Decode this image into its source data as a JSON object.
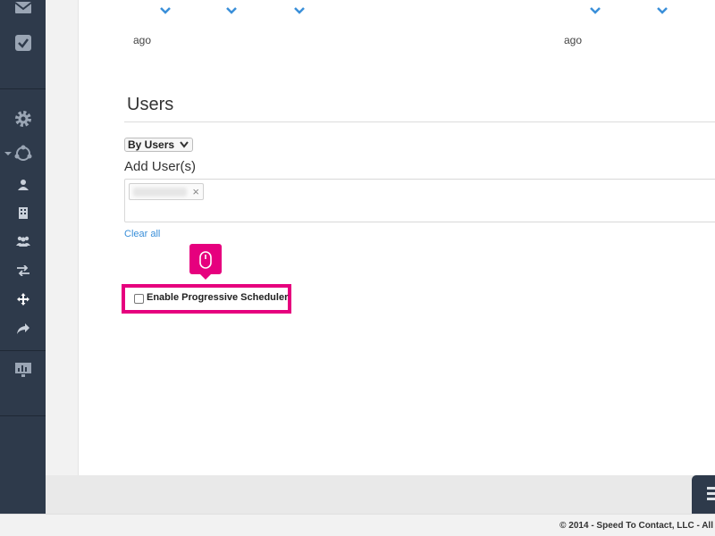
{
  "sidebar": {
    "icons": [
      {
        "name": "mail-icon"
      },
      {
        "name": "tasks-icon"
      },
      {
        "name": "gear-icon"
      },
      {
        "name": "workflow-icon"
      },
      {
        "name": "user-icon"
      },
      {
        "name": "building-icon"
      },
      {
        "name": "group-icon"
      },
      {
        "name": "transfer-icon"
      },
      {
        "name": "move-icon"
      },
      {
        "name": "forward-icon"
      },
      {
        "name": "monitor-chart-icon"
      }
    ],
    "accent": "#2e3a4b"
  },
  "top_row": {
    "ago_left": "ago",
    "ago_right": "ago",
    "chevron_color": "#3a8fd9"
  },
  "users_section": {
    "title": "Users",
    "filter_select": {
      "selected": "By Users"
    },
    "add_label": "Add User(s)",
    "tokens": [
      {
        "label": "••••••••",
        "remove_glyph": "×"
      }
    ],
    "clear_all": "Clear all",
    "progressive_checkbox": {
      "label": "Enable Progressive Scheduler",
      "checked": false
    }
  },
  "highlight_color": "#e6007e",
  "footer": {
    "text": "© 2014 - Speed To Contact, LLC - All"
  }
}
